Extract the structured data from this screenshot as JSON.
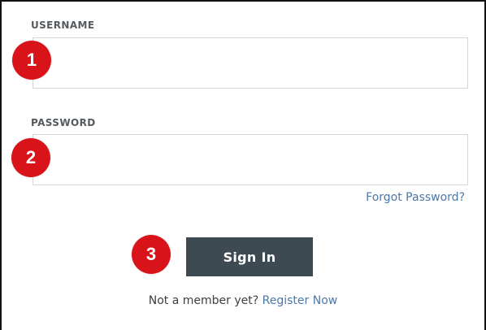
{
  "form": {
    "username": {
      "label": "USERNAME",
      "value": "",
      "placeholder": ""
    },
    "password": {
      "label": "PASSWORD",
      "value": "",
      "placeholder": ""
    },
    "forgot_password_link": "Forgot Password?",
    "sign_in_label": "Sign In",
    "register_prompt": "Not a member yet?",
    "register_link": "Register Now"
  },
  "annotations": {
    "badge_1": "1",
    "badge_2": "2",
    "badge_3": "3"
  },
  "colors": {
    "badge": "#d8141a",
    "button": "#3e4a52",
    "link": "#4b78a8",
    "label": "#555a5e",
    "field_border": "#d4d6d8"
  }
}
